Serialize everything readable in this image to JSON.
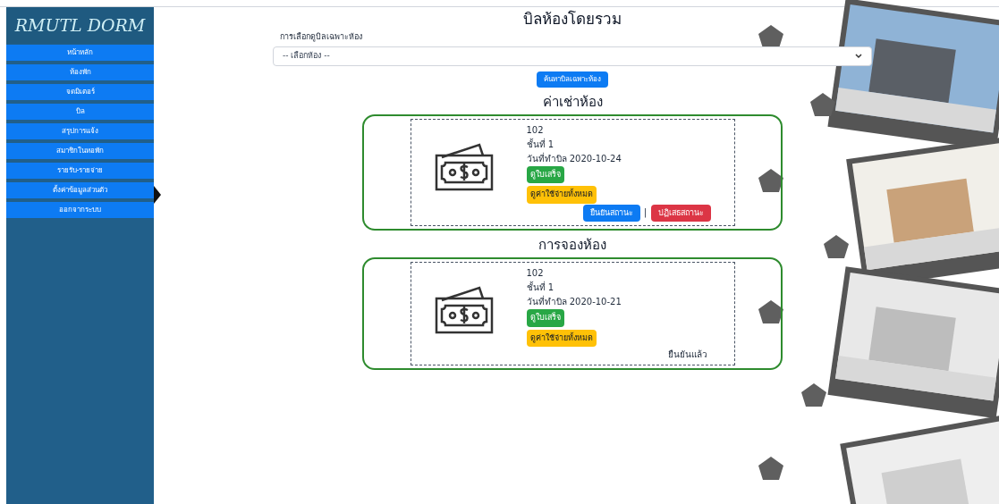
{
  "logo": {
    "text": "RMUTL DORM"
  },
  "sidebar": {
    "items": [
      {
        "label": "หน้าหลัก"
      },
      {
        "label": "ห้องพัก"
      },
      {
        "label": "จดมิเตอร์"
      },
      {
        "label": "บิล"
      },
      {
        "label": "สรุปการแจ้ง"
      },
      {
        "label": "สมาชิกในหอพัก"
      },
      {
        "label": "รายรับ-รายจ่าย"
      },
      {
        "label": "ตั้งค่าข้อมูลส่วนตัว"
      },
      {
        "label": "ออกจากระบบ"
      }
    ]
  },
  "page_title": "บิลห้องโดยรวม",
  "filter": {
    "label": "การเลือกดูบิลเฉพาะห้อง",
    "select_value": "-- เลือกห้อง --",
    "button": "ค้นหาบิลเฉพาะห้อง"
  },
  "sections": [
    {
      "heading": "ค่าเช่าห้อง",
      "bill": {
        "room": "102",
        "floor": "ชั้นที่ 1",
        "date": "วันที่ทำบิล 2020-10-24",
        "receipt_button": "ดูใบเสร็จ",
        "expenses_button": "ดูค่าใช้จ่ายทั้งหมด",
        "kind": "pending",
        "confirm_button": "ยืนยันสถานะ",
        "separator": "|",
        "reject_button": "ปฏิเสธสถานะ"
      }
    },
    {
      "heading": "การจองห้อง",
      "bill": {
        "room": "102",
        "floor": "ชั้นที่ 1",
        "date": "วันที่ทำบิล 2020-10-21",
        "receipt_button": "ดูใบเสร็จ",
        "expenses_button": "ดูค่าใช้จ่ายทั้งหมด",
        "kind": "confirmed",
        "status": "ยืนยันแล้ว"
      }
    }
  ]
}
